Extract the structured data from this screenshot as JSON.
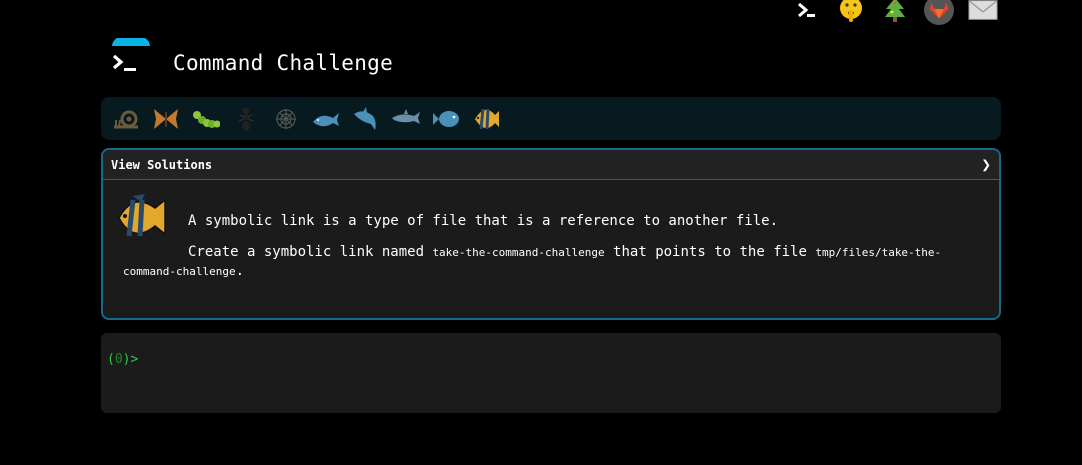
{
  "header": {
    "title": "Command Challenge",
    "icons": [
      "terminal-icon",
      "shushing-face-icon",
      "tree-icon",
      "gitlab-icon",
      "envelope-icon"
    ]
  },
  "levels": [
    "snail",
    "butterfly",
    "caterpillar",
    "ant",
    "spider-web",
    "whale",
    "shark",
    "dolphin",
    "blowfish",
    "tropical-fish"
  ],
  "challenge": {
    "header_label": "View Solutions",
    "chevron": "❯",
    "paragraph1": "A symbolic link is a type of file that is a reference to another file.",
    "p2_before": "Create a symbolic link named ",
    "p2_code1": "take-the-command-challenge",
    "p2_middle": " that points to the file ",
    "p2_code2": "tmp/files/take-the-command-challenge",
    "p2_end": "."
  },
  "terminal": {
    "prompt_open": "(",
    "prompt_code": "0",
    "prompt_close": ")>"
  },
  "colors": {
    "accent": "#176a85",
    "level_bar_bg": "#071a20",
    "prompt_green": "#2ecc40",
    "card_bg": "#1b1b1b"
  }
}
